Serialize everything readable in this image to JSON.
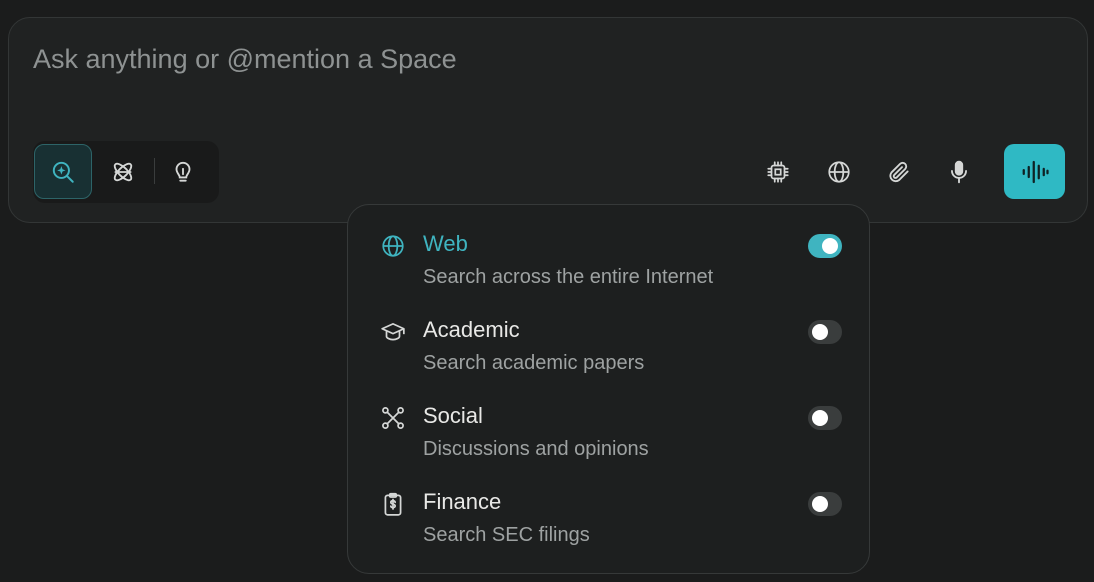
{
  "composer": {
    "placeholder": "Ask anything or @mention a Space"
  },
  "modes": [
    {
      "name": "search",
      "icon": "search-sparkle-icon",
      "active": true
    },
    {
      "name": "research",
      "icon": "research-atom-icon",
      "active": false
    },
    {
      "name": "labs",
      "icon": "lightbulb-icon",
      "active": false
    }
  ],
  "tools": [
    {
      "icon": "chip-icon"
    },
    {
      "icon": "globe-icon"
    },
    {
      "icon": "paperclip-icon"
    },
    {
      "icon": "microphone-icon"
    }
  ],
  "send": {
    "icon": "voice-waveform-icon"
  },
  "sources": [
    {
      "title": "Web",
      "desc": "Search across the entire Internet",
      "icon": "globe-icon",
      "enabled": true
    },
    {
      "title": "Academic",
      "desc": "Search academic papers",
      "icon": "graduation-cap-icon",
      "enabled": false
    },
    {
      "title": "Social",
      "desc": "Discussions and opinions",
      "icon": "network-icon",
      "enabled": false
    },
    {
      "title": "Finance",
      "desc": "Search SEC filings",
      "icon": "clipboard-dollar-icon",
      "enabled": false
    }
  ],
  "colors": {
    "accent": "#3fb4c0",
    "send_bg": "#2fb9c4",
    "background": "#1b1c1c",
    "panel": "#202222"
  }
}
